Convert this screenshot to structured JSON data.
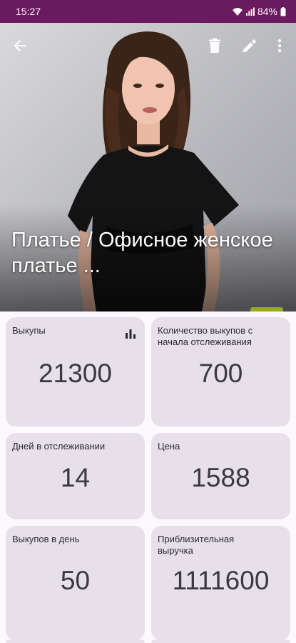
{
  "status_bar": {
    "time": "15:27",
    "battery": "84%",
    "icons": [
      "wifi-icon",
      "signal-icon",
      "battery-icon"
    ]
  },
  "toolbar": {
    "icons": [
      "back-arrow-icon",
      "delete-icon",
      "edit-icon",
      "more-vert-icon"
    ]
  },
  "product": {
    "title": "Платье / Офисное женское платье ..."
  },
  "stats": [
    {
      "label": "Выкупы",
      "value": "21300",
      "icon": "bar-chart-icon"
    },
    {
      "label": "Количество выкупов с начала отслеживания",
      "value": "700"
    },
    {
      "label": "Дней в отслеживании",
      "value": "14"
    },
    {
      "label": "Цена",
      "value": "1588"
    },
    {
      "label": "Выкупов в день",
      "value": "50"
    },
    {
      "label": "Приблизительная выручка",
      "value": "1111600"
    }
  ],
  "colors": {
    "status_bar": "#6a1a5e",
    "card": "#e7e0ea",
    "background": "#fcf8fd"
  }
}
